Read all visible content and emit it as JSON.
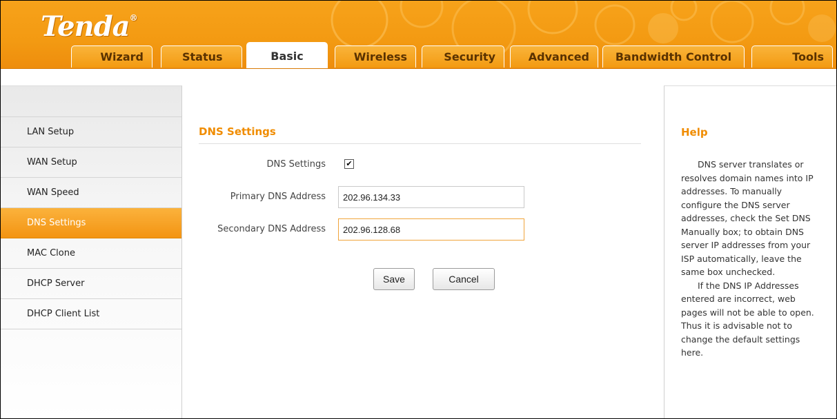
{
  "brand": {
    "logo_text": "Tenda",
    "registered_mark": "®"
  },
  "tabs": [
    {
      "label": "Wizard"
    },
    {
      "label": "Status"
    },
    {
      "label": "Basic"
    },
    {
      "label": "Wireless"
    },
    {
      "label": "Security"
    },
    {
      "label": "Advanced"
    },
    {
      "label": "Bandwidth Control"
    },
    {
      "label": "Tools"
    }
  ],
  "active_tab": "Basic",
  "sidebar": {
    "items": [
      {
        "label": "LAN Setup"
      },
      {
        "label": "WAN Setup"
      },
      {
        "label": "WAN Speed"
      },
      {
        "label": "DNS Settings"
      },
      {
        "label": "MAC Clone"
      },
      {
        "label": "DHCP Server"
      },
      {
        "label": "DHCP Client List"
      }
    ],
    "active_item": "DNS Settings"
  },
  "form": {
    "title": "DNS Settings",
    "dns_checkbox_label": "DNS Settings",
    "dns_checked": "✔",
    "primary_label": "Primary DNS Address",
    "primary_value": "202.96.134.33",
    "secondary_label": "Secondary DNS Address",
    "secondary_value": "202.96.128.68",
    "save_label": "Save",
    "cancel_label": "Cancel"
  },
  "help": {
    "title": "Help",
    "para1": "DNS server translates or resolves domain names into IP addresses. To manually configure the DNS server addresses, check the Set DNS Manually box; to obtain DNS server IP addresses from your ISP automatically, leave the same box unchecked.",
    "para2": "If the DNS IP Addresses entered are incorrect, web pages will not be able to open. Thus it is advisable not to change the default settings here."
  },
  "colors": {
    "accent": "#f39a12",
    "title": "#f08c00",
    "focus_border": "#f0a43a"
  }
}
